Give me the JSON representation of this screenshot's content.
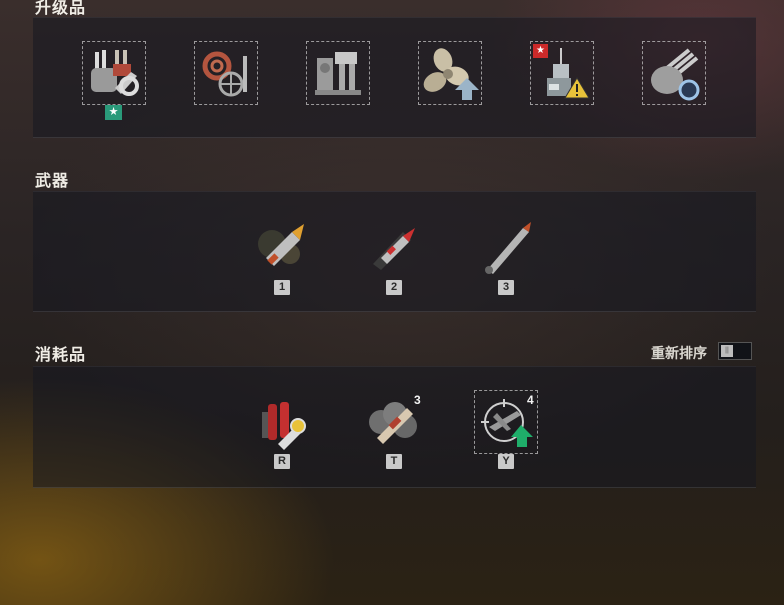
{
  "sections": {
    "upgrades": {
      "title": "升级品"
    },
    "weapons": {
      "title": "武器"
    },
    "consumables": {
      "title": "消耗品",
      "reorder_label": "重新排序"
    }
  },
  "upgrades": [
    {
      "icon": "main-battery-upgrade-icon",
      "badge": "★",
      "badge_color": "#2a9a7a"
    },
    {
      "icon": "damage-control-upgrade-icon"
    },
    {
      "icon": "engine-room-upgrade-icon"
    },
    {
      "icon": "propulsion-upgrade-icon"
    },
    {
      "icon": "ship-concealment-upgrade-icon",
      "badge": "★",
      "badge_color": "#cc2a2a"
    },
    {
      "icon": "gun-reload-upgrade-icon"
    }
  ],
  "weapons": [
    {
      "icon": "he-shell-icon",
      "hotkey": "1"
    },
    {
      "icon": "ap-shell-icon",
      "hotkey": "2"
    },
    {
      "icon": "torpedo-icon",
      "hotkey": "3"
    }
  ],
  "consumables": [
    {
      "icon": "damage-control-party-icon",
      "hotkey": "R"
    },
    {
      "icon": "smoke-generator-icon",
      "hotkey": "T",
      "count": "3"
    },
    {
      "icon": "spotter-aircraft-icon",
      "hotkey": "Y",
      "count": "4"
    }
  ]
}
